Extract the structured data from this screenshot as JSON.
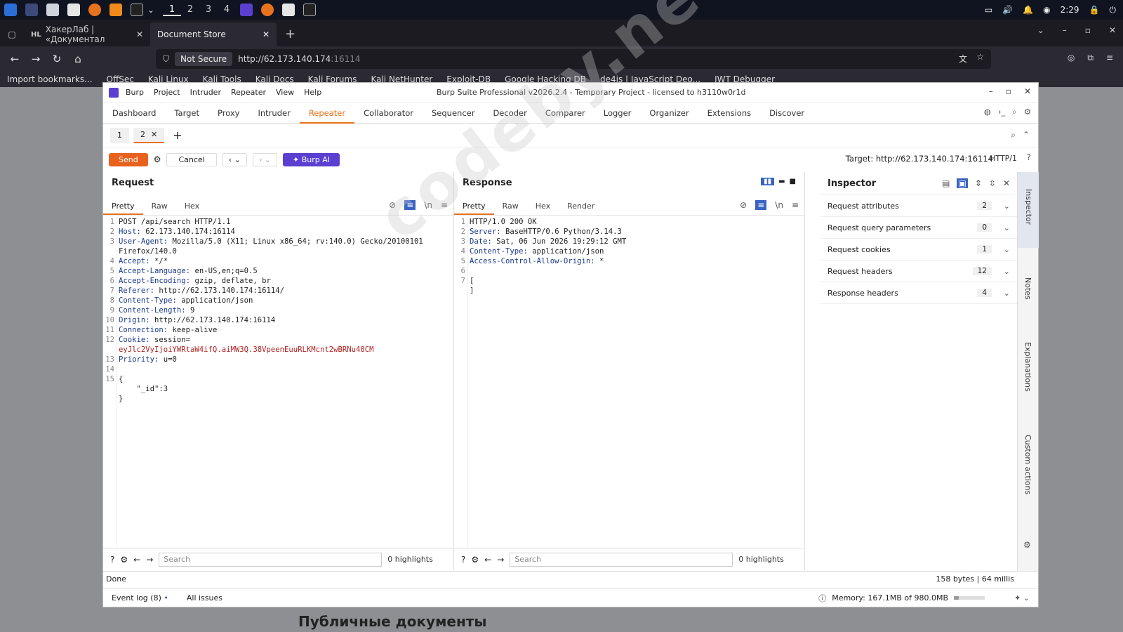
{
  "taskbar": {
    "workspaces": [
      "1",
      "2",
      "3",
      "4"
    ],
    "time": "2:29"
  },
  "browser": {
    "tabs": [
      {
        "label": "ХакерЛаб | «Документал"
      },
      {
        "label": "Document Store"
      }
    ],
    "not_secure": "Not Secure",
    "url_host": "http://62.173.140.174",
    "url_port": ":16114",
    "bookmarks": [
      "Import bookmarks...",
      "OffSec",
      "Kali Linux",
      "Kali Tools",
      "Kali Docs",
      "Kali Forums",
      "Kali NetHunter",
      "Exploit-DB",
      "Google Hacking DB",
      "de4js | JavaScript Deo...",
      "JWT Debugger"
    ]
  },
  "page": {
    "heading": "Публичные документы"
  },
  "burp": {
    "menu": [
      "Burp",
      "Project",
      "Intruder",
      "Repeater",
      "View",
      "Help"
    ],
    "window_title": "Burp Suite Professional v2026.2.4 - Temporary Project - licensed to h3110w0r1d",
    "nav": [
      "Dashboard",
      "Target",
      "Proxy",
      "Intruder",
      "Repeater",
      "Collaborator",
      "Sequencer",
      "Decoder",
      "Comparer",
      "Logger",
      "Organizer",
      "Extensions",
      "Discover"
    ],
    "active_nav": "Repeater",
    "subtabs": [
      "1",
      "2"
    ],
    "send": "Send",
    "cancel": "Cancel",
    "burp_ai": "Burp AI",
    "target": "Target: http://62.173.140.174:16114",
    "http_version": "HTTP/1",
    "request": {
      "title": "Request",
      "tabs": [
        "Pretty",
        "Raw",
        "Hex"
      ],
      "lines": [
        {
          "n": "1",
          "k": "",
          "v": "POST /api/search HTTP/1.1"
        },
        {
          "n": "2",
          "k": "Host:",
          "v": " 62.173.140.174:16114"
        },
        {
          "n": "3",
          "k": "User-Agent:",
          "v": " Mozilla/5.0 (X11; Linux x86_64; rv:140.0) Gecko/20100101"
        },
        {
          "n": "",
          "k": "",
          "v": "Firefox/140.0"
        },
        {
          "n": "4",
          "k": "Accept:",
          "v": " */*"
        },
        {
          "n": "5",
          "k": "Accept-Language:",
          "v": " en-US,en;q=0.5"
        },
        {
          "n": "6",
          "k": "Accept-Encoding:",
          "v": " gzip, deflate, br"
        },
        {
          "n": "7",
          "k": "Referer:",
          "v": " http://62.173.140.174:16114/"
        },
        {
          "n": "8",
          "k": "Content-Type:",
          "v": " application/json"
        },
        {
          "n": "9",
          "k": "Content-Length:",
          "v": " 9"
        },
        {
          "n": "10",
          "k": "Origin:",
          "v": " http://62.173.140.174:16114"
        },
        {
          "n": "11",
          "k": "Connection:",
          "v": " keep-alive"
        },
        {
          "n": "12",
          "k": "Cookie:",
          "v": " session="
        },
        {
          "n": "",
          "k": "",
          "v": "eyJlc2VyIjoiYWRtaW4ifQ.aiMW3Q.38VpeenEuuRLKMcnt2wBRNu48CM",
          "red": true
        },
        {
          "n": "13",
          "k": "Priority:",
          "v": " u=0"
        },
        {
          "n": "14",
          "k": "",
          "v": ""
        },
        {
          "n": "15",
          "k": "",
          "v": "{"
        },
        {
          "n": "",
          "k": "",
          "v": "    \"_id\":3"
        },
        {
          "n": "",
          "k": "",
          "v": "}"
        }
      ]
    },
    "response": {
      "title": "Response",
      "tabs": [
        "Pretty",
        "Raw",
        "Hex",
        "Render"
      ],
      "lines": [
        {
          "n": "1",
          "k": "",
          "v": "HTTP/1.0 200 OK"
        },
        {
          "n": "2",
          "k": "Server:",
          "v": " BaseHTTP/0.6 Python/3.14.3"
        },
        {
          "n": "3",
          "k": "Date:",
          "v": " Sat, 06 Jun 2026 19:29:12 GMT"
        },
        {
          "n": "4",
          "k": "Content-Type:",
          "v": " application/json"
        },
        {
          "n": "5",
          "k": "Access-Control-Allow-Origin:",
          "v": " *"
        },
        {
          "n": "6",
          "k": "",
          "v": ""
        },
        {
          "n": "7",
          "k": "",
          "v": "["
        },
        {
          "n": "",
          "k": "",
          "v": "]"
        }
      ]
    },
    "search_placeholder": "Search",
    "highlights": "0 highlights",
    "inspector": {
      "title": "Inspector",
      "rows": [
        {
          "label": "Request attributes",
          "count": "2"
        },
        {
          "label": "Request query parameters",
          "count": "0"
        },
        {
          "label": "Request cookies",
          "count": "1"
        },
        {
          "label": "Request headers",
          "count": "12"
        },
        {
          "label": "Response headers",
          "count": "4"
        }
      ]
    },
    "sidebar": [
      "Inspector",
      "Notes",
      "Explanations",
      "Custom actions"
    ],
    "status": {
      "left": "Done",
      "right": "158 bytes | 64 millis"
    },
    "footer": {
      "event_log": "Event log (8)",
      "all_issues": "All issues",
      "memory": "Memory: 167.1MB of 980.0MB"
    }
  },
  "watermark": "codeby.net",
  "colors": {
    "accent": "#e8611d",
    "burp_ai": "#5a3fd0"
  }
}
